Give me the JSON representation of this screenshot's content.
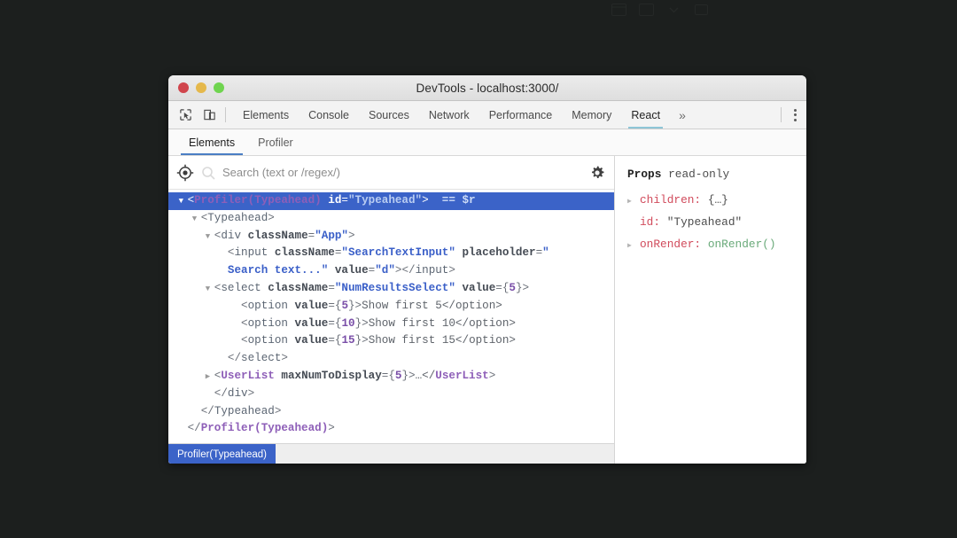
{
  "window": {
    "title": "DevTools - localhost:3000/",
    "traffic_lights": [
      {
        "name": "close",
        "color": "#d0454c"
      },
      {
        "name": "minimize",
        "color": "#e5b84b"
      },
      {
        "name": "zoom",
        "color": "#6fd44f"
      }
    ]
  },
  "toolbar": {
    "inspect_icon": "inspect-cursor-icon",
    "device_icon": "device-toolbar-icon",
    "overflow_label": "»",
    "menu_icon": "kebab-menu-icon"
  },
  "devtools_tabs": [
    {
      "label": "Elements",
      "active": false
    },
    {
      "label": "Console",
      "active": false
    },
    {
      "label": "Sources",
      "active": false
    },
    {
      "label": "Network",
      "active": false
    },
    {
      "label": "Performance",
      "active": false
    },
    {
      "label": "Memory",
      "active": false
    },
    {
      "label": "React",
      "active": true
    }
  ],
  "react_subtabs": [
    {
      "label": "Elements",
      "active": true
    },
    {
      "label": "Profiler",
      "active": false
    }
  ],
  "search": {
    "placeholder": "Search (text or /regex/)",
    "value": "",
    "select_icon": "target-crosshair-icon",
    "search_icon": "search-icon",
    "settings_icon": "gear-icon"
  },
  "tree": [
    {
      "indent": 0,
      "arrow": "open",
      "selected": true,
      "parts": [
        {
          "t": "punct",
          "s": "<"
        },
        {
          "t": "tagc",
          "s": "Profiler(Typeahead)"
        },
        {
          "t": "plain",
          "s": " "
        },
        {
          "t": "attr",
          "s": "id"
        },
        {
          "t": "punct",
          "s": "="
        },
        {
          "t": "str",
          "s": "\"Typeahead\""
        },
        {
          "t": "punct",
          "s": ">"
        },
        {
          "t": "plain",
          "s": "  "
        },
        {
          "t": "dollar",
          "s": "== $r"
        }
      ]
    },
    {
      "indent": 1,
      "arrow": "open",
      "selected": false,
      "parts": [
        {
          "t": "punct",
          "s": "<"
        },
        {
          "t": "tag",
          "s": "Typeahead"
        },
        {
          "t": "punct",
          "s": ">"
        }
      ]
    },
    {
      "indent": 2,
      "arrow": "open",
      "selected": false,
      "parts": [
        {
          "t": "punct",
          "s": "<"
        },
        {
          "t": "tag",
          "s": "div"
        },
        {
          "t": "plain",
          "s": " "
        },
        {
          "t": "attr",
          "s": "className"
        },
        {
          "t": "punct",
          "s": "="
        },
        {
          "t": "str",
          "s": "\"App\""
        },
        {
          "t": "punct",
          "s": ">"
        }
      ]
    },
    {
      "indent": 3,
      "arrow": "none",
      "selected": false,
      "parts": [
        {
          "t": "punct",
          "s": "<"
        },
        {
          "t": "tag",
          "s": "input"
        },
        {
          "t": "plain",
          "s": " "
        },
        {
          "t": "attr",
          "s": "className"
        },
        {
          "t": "punct",
          "s": "="
        },
        {
          "t": "str",
          "s": "\"SearchTextInput\""
        },
        {
          "t": "plain",
          "s": " "
        },
        {
          "t": "attr",
          "s": "placeholder"
        },
        {
          "t": "punct",
          "s": "="
        },
        {
          "t": "str",
          "s": "\""
        }
      ]
    },
    {
      "indent": 3,
      "arrow": "none",
      "selected": false,
      "nobullet": true,
      "parts": [
        {
          "t": "str",
          "s": "Search text...\""
        },
        {
          "t": "plain",
          "s": " "
        },
        {
          "t": "attr",
          "s": "value"
        },
        {
          "t": "punct",
          "s": "="
        },
        {
          "t": "str",
          "s": "\"d\""
        },
        {
          "t": "punct",
          "s": "></"
        },
        {
          "t": "tag",
          "s": "input"
        },
        {
          "t": "punct",
          "s": ">"
        }
      ]
    },
    {
      "indent": 2,
      "arrow": "open",
      "selected": false,
      "parts": [
        {
          "t": "punct",
          "s": "<"
        },
        {
          "t": "tag",
          "s": "select"
        },
        {
          "t": "plain",
          "s": " "
        },
        {
          "t": "attr",
          "s": "className"
        },
        {
          "t": "punct",
          "s": "="
        },
        {
          "t": "str",
          "s": "\"NumResultsSelect\""
        },
        {
          "t": "plain",
          "s": " "
        },
        {
          "t": "attr",
          "s": "value"
        },
        {
          "t": "punct",
          "s": "="
        },
        {
          "t": "punct",
          "s": "{"
        },
        {
          "t": "num",
          "s": "5"
        },
        {
          "t": "punct",
          "s": "}>"
        }
      ]
    },
    {
      "indent": 4,
      "arrow": "none",
      "selected": false,
      "parts": [
        {
          "t": "punct",
          "s": "<"
        },
        {
          "t": "tag",
          "s": "option"
        },
        {
          "t": "plain",
          "s": " "
        },
        {
          "t": "attr",
          "s": "value"
        },
        {
          "t": "punct",
          "s": "="
        },
        {
          "t": "punct",
          "s": "{"
        },
        {
          "t": "num",
          "s": "5"
        },
        {
          "t": "punct",
          "s": "}>"
        },
        {
          "t": "plain",
          "s": "Show first 5</"
        },
        {
          "t": "plain",
          "s": "option>"
        }
      ]
    },
    {
      "indent": 4,
      "arrow": "none",
      "selected": false,
      "parts": [
        {
          "t": "punct",
          "s": "<"
        },
        {
          "t": "tag",
          "s": "option"
        },
        {
          "t": "plain",
          "s": " "
        },
        {
          "t": "attr",
          "s": "value"
        },
        {
          "t": "punct",
          "s": "="
        },
        {
          "t": "punct",
          "s": "{"
        },
        {
          "t": "num",
          "s": "10"
        },
        {
          "t": "punct",
          "s": "}>"
        },
        {
          "t": "plain",
          "s": "Show first 10</"
        },
        {
          "t": "plain",
          "s": "option>"
        }
      ]
    },
    {
      "indent": 4,
      "arrow": "none",
      "selected": false,
      "parts": [
        {
          "t": "punct",
          "s": "<"
        },
        {
          "t": "tag",
          "s": "option"
        },
        {
          "t": "plain",
          "s": " "
        },
        {
          "t": "attr",
          "s": "value"
        },
        {
          "t": "punct",
          "s": "="
        },
        {
          "t": "punct",
          "s": "{"
        },
        {
          "t": "num",
          "s": "15"
        },
        {
          "t": "punct",
          "s": "}>"
        },
        {
          "t": "plain",
          "s": "Show first 15</"
        },
        {
          "t": "plain",
          "s": "option>"
        }
      ]
    },
    {
      "indent": 3,
      "arrow": "none",
      "selected": false,
      "parts": [
        {
          "t": "punct",
          "s": "</"
        },
        {
          "t": "tag",
          "s": "select"
        },
        {
          "t": "punct",
          "s": ">"
        }
      ]
    },
    {
      "indent": 2,
      "arrow": "closed",
      "selected": false,
      "parts": [
        {
          "t": "punct",
          "s": "<"
        },
        {
          "t": "tagc",
          "s": "UserList"
        },
        {
          "t": "plain",
          "s": " "
        },
        {
          "t": "attr",
          "s": "maxNumToDisplay"
        },
        {
          "t": "punct",
          "s": "="
        },
        {
          "t": "punct",
          "s": "{"
        },
        {
          "t": "num",
          "s": "5"
        },
        {
          "t": "punct",
          "s": "}>"
        },
        {
          "t": "plain",
          "s": "…</"
        },
        {
          "t": "tagc",
          "s": "UserList"
        },
        {
          "t": "punct",
          "s": ">"
        }
      ]
    },
    {
      "indent": 2,
      "arrow": "none",
      "selected": false,
      "parts": [
        {
          "t": "punct",
          "s": "</"
        },
        {
          "t": "tag",
          "s": "div"
        },
        {
          "t": "punct",
          "s": ">"
        }
      ]
    },
    {
      "indent": 1,
      "arrow": "none",
      "selected": false,
      "parts": [
        {
          "t": "punct",
          "s": "</"
        },
        {
          "t": "tag",
          "s": "Typeahead"
        },
        {
          "t": "punct",
          "s": ">"
        }
      ]
    },
    {
      "indent": 0,
      "arrow": "none",
      "selected": false,
      "parts": [
        {
          "t": "punct",
          "s": "</"
        },
        {
          "t": "tagc",
          "s": "Profiler(Typeahead)"
        },
        {
          "t": "punct",
          "s": ">"
        }
      ]
    }
  ],
  "breadcrumb": {
    "items": [
      "Profiler(Typeahead)"
    ]
  },
  "props": {
    "title": "Props",
    "readonly_label": "read-only",
    "rows": [
      {
        "arrow": "closed",
        "key": "children:",
        "value": "{…}",
        "fn": false
      },
      {
        "arrow": "none",
        "key": "id:",
        "value": "\"Typeahead\"",
        "fn": false
      },
      {
        "arrow": "closed",
        "key": "onRender:",
        "value": "onRender()",
        "fn": true
      }
    ]
  },
  "colors": {
    "selection_blue": "#3b63c8",
    "react_tab_underline": "#8ec5d6",
    "subtab_underline": "#4a7ec4",
    "prop_key": "#d14b5c",
    "prop_fn": "#6aaa7a",
    "backdrop": "#1c1f1e"
  }
}
